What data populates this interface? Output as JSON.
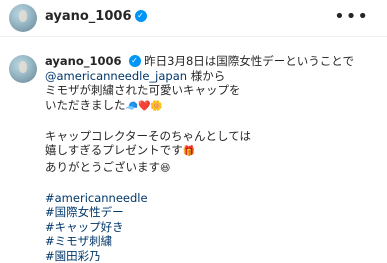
{
  "header": {
    "username": "ayano_1006",
    "verified_icon": "verified-badge",
    "more_label": "•••"
  },
  "caption": {
    "username": "ayano_1006",
    "line1": "昨日3月8日は国際女性デーということで",
    "mention": "@americanneedle_japan",
    "line2_suffix": " 様から",
    "line3": "ミモザが刺繍された可愛いキャップを",
    "line4": "いただきました",
    "line4_emoji": "🧢❤️🌼",
    "line5": "キャップコレクターそのちゃんとしては",
    "line6": "嬉しすぎるプレゼントです",
    "line6_emoji": "🎁",
    "line7": "ありがとうございます",
    "line7_emoji": "😆",
    "hashtags": [
      "#americanneedle",
      "#国際女性デー",
      "#キャップ好き",
      "#ミモザ刺繍",
      "#園田彩乃"
    ]
  },
  "colors": {
    "link": "#00376b",
    "verified": "#0095f6"
  }
}
